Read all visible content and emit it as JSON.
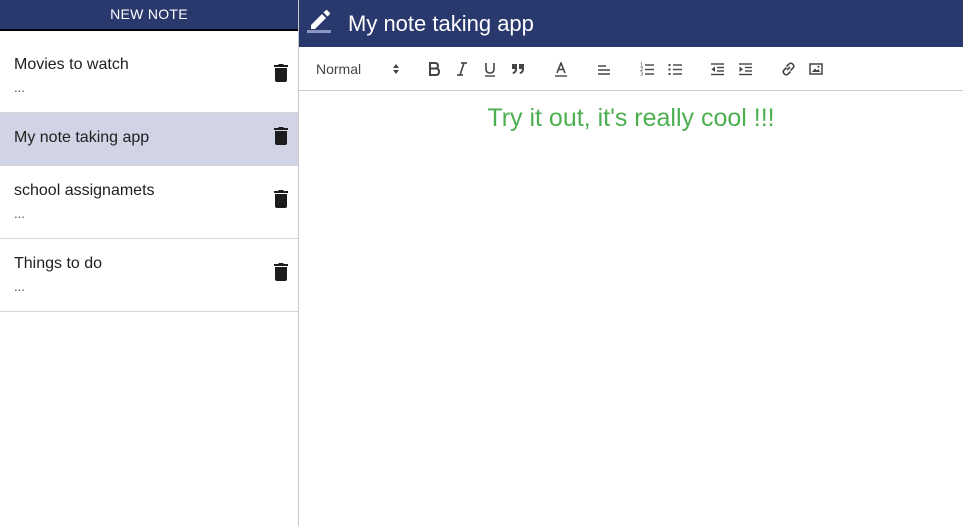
{
  "sidebar": {
    "new_note_label": "NEW NOTE",
    "notes": [
      {
        "title": "Movies to watch",
        "preview": "...",
        "selected": false
      },
      {
        "title": "My note taking app",
        "preview": "",
        "selected": true
      },
      {
        "title": "school assignamets",
        "preview": "...",
        "selected": false
      },
      {
        "title": "Things to do",
        "preview": "...",
        "selected": false
      }
    ]
  },
  "editor": {
    "title": "My note taking app",
    "header_select": "Normal",
    "content": "Try it out, it's really cool !!!"
  },
  "toolbar_icons": [
    "bold-icon",
    "italic-icon",
    "underline-icon",
    "blockquote-icon",
    "text-color-icon",
    "align-icon",
    "ordered-list-icon",
    "bullet-list-icon",
    "outdent-icon",
    "indent-icon",
    "link-icon",
    "image-icon"
  ],
  "colors": {
    "header_bg": "#29396e",
    "selected_bg": "#d0d4e4",
    "content_text": "#4caf50"
  }
}
